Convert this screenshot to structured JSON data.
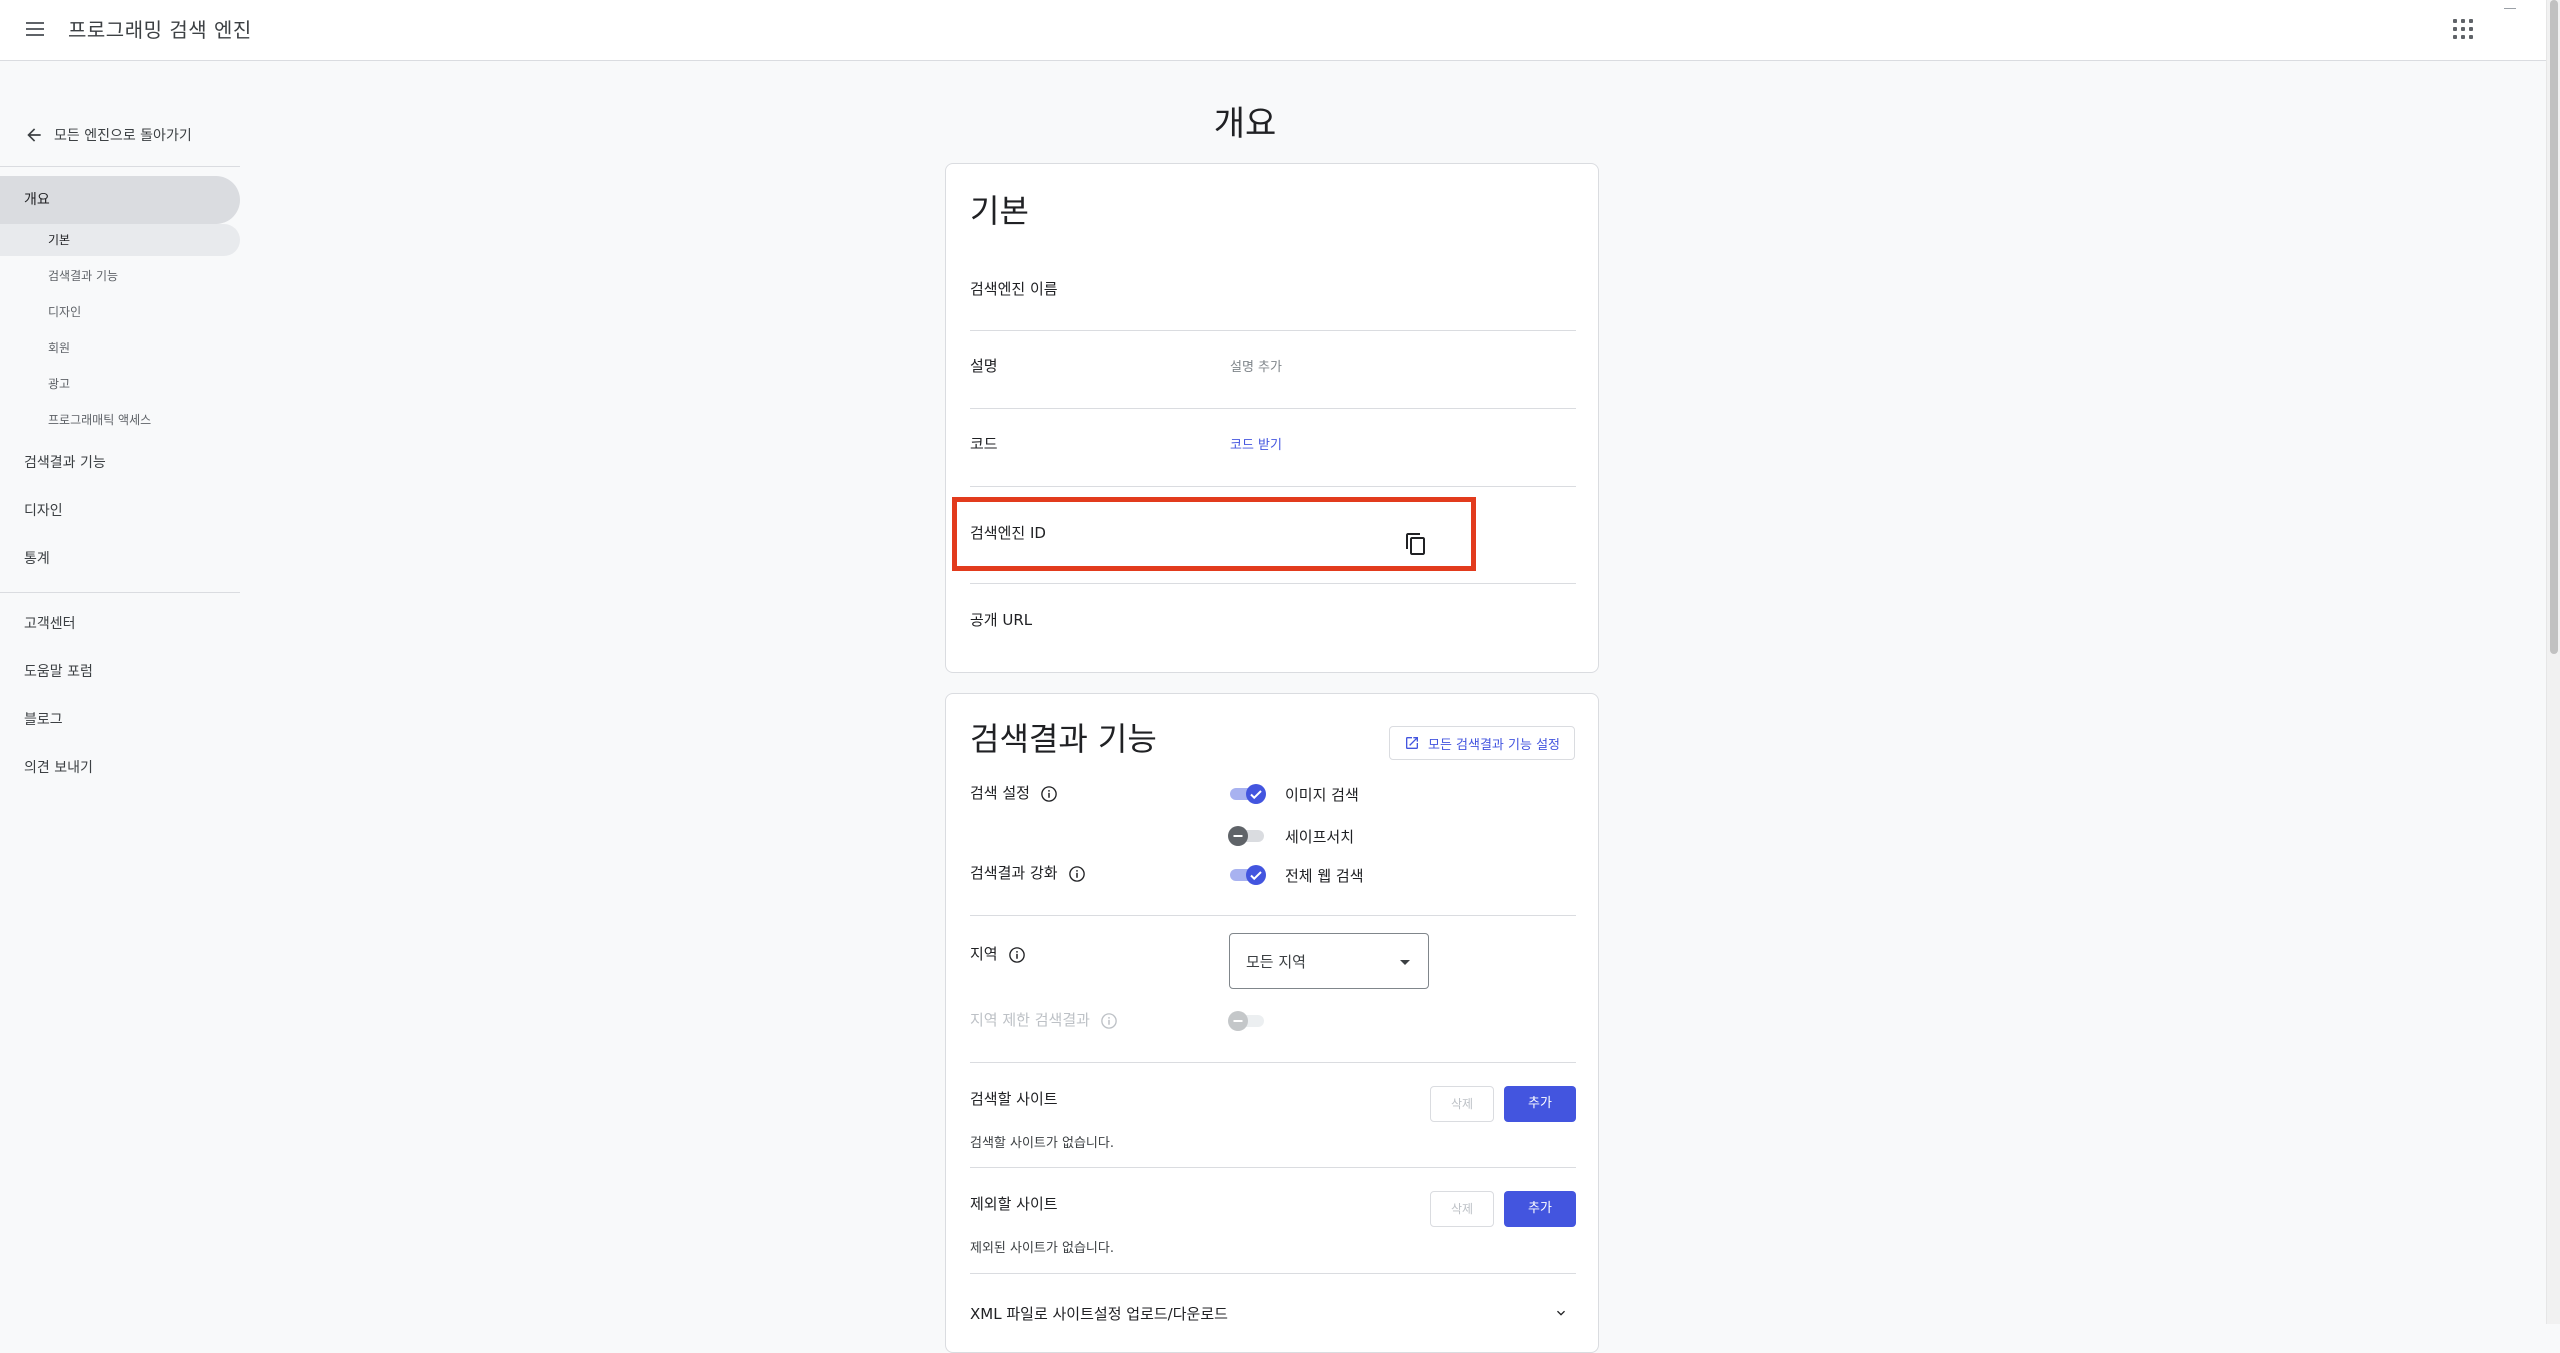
{
  "header": {
    "app_title": "프로그래밍 검색 엔진"
  },
  "sidebar": {
    "back_label": "모든 엔진으로 돌아가기",
    "overview": "개요",
    "overview_sub": [
      "기본",
      "검색결과 기능",
      "디자인",
      "회원",
      "광고",
      "프로그래매틱 액세스"
    ],
    "main_items": [
      "검색결과 기능",
      "디자인",
      "통계"
    ],
    "help_items": [
      "고객센터",
      "도움말 포럼",
      "블로그",
      "의견 보내기"
    ]
  },
  "main": {
    "page_title": "개요",
    "basic": {
      "title": "기본",
      "rows": {
        "engine_name": "검색엔진 이름",
        "description": "설명",
        "description_value": "설명 추가",
        "code": "코드",
        "code_value": "코드 받기",
        "engine_id": "검색엔진 ID",
        "public_url": "공개 URL"
      }
    },
    "features": {
      "title": "검색결과 기능",
      "settings_button": "모든 검색결과 기능 설정",
      "search_settings_label": "검색 설정",
      "image_search": "이미지 검색",
      "image_search_on": true,
      "safesearch": "세이프서치",
      "safesearch_on": false,
      "enhance_label": "검색결과 강화",
      "web_search": "전체 웹 검색",
      "web_search_on": true,
      "region_label": "지역",
      "region_value": "모든 지역",
      "region_restrict_label": "지역 제한 검색결과",
      "sites_to_search": "검색할 사이트",
      "sites_to_search_empty": "검색할 사이트가 없습니다.",
      "sites_to_exclude": "제외할 사이트",
      "sites_to_exclude_empty": "제외된 사이트가 없습니다.",
      "delete_label": "삭제",
      "add_label": "추가",
      "xml_label": "XML 파일로 사이트설정 업로드/다운로드"
    }
  },
  "colors": {
    "accent": "#4355df",
    "highlight": "#e23b1d",
    "sidebar_active": "#dadce0"
  }
}
